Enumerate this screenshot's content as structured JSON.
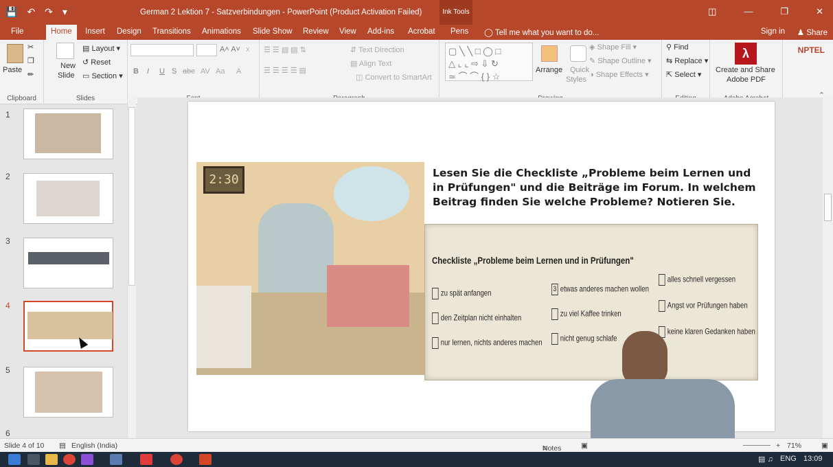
{
  "window": {
    "title": "German 2 Lektion 7 - Satzverbindungen - PowerPoint (Product Activation Failed)",
    "context_tab": "Ink Tools",
    "quick_access": [
      "save-icon",
      "undo-icon",
      "redo-icon",
      "customize-icon"
    ]
  },
  "tabs": [
    "File",
    "Home",
    "Insert",
    "Design",
    "Transitions",
    "Animations",
    "Slide Show",
    "Review",
    "View",
    "Add-ins",
    "Acrobat",
    "Pens"
  ],
  "active_tab": "Home",
  "tell_me": "Tell me what you want to do...",
  "account": {
    "signin": "Sign in",
    "share": "Share"
  },
  "ribbon": {
    "clipboard": {
      "label": "Clipboard",
      "paste": "Paste"
    },
    "slides": {
      "label": "Slides",
      "new_slide": "New",
      "new_slide2": "Slide",
      "layout": "Layout",
      "reset": "Reset",
      "section": "Section"
    },
    "font": {
      "label": "Font"
    },
    "paragraph": {
      "label": "Paragraph",
      "text_direction": "Text Direction",
      "align_text": "Align Text",
      "convert": "Convert to SmartArt"
    },
    "drawing": {
      "label": "Drawing",
      "arrange": "Arrange",
      "quick_styles": "Quick",
      "quick_styles2": "Styles",
      "shape_fill": "Shape Fill",
      "shape_outline": "Shape Outline",
      "shape_effects": "Shape Effects"
    },
    "editing": {
      "label": "Editing",
      "find": "Find",
      "replace": "Replace",
      "select": "Select"
    },
    "acrobat": {
      "label": "Adobe Acrobat",
      "create": "Create and Share",
      "create2": "Adobe PDF"
    },
    "watermark": "NPTEL"
  },
  "thumbnails": [
    {
      "num": "1"
    },
    {
      "num": "2"
    },
    {
      "num": "3"
    },
    {
      "num": "4",
      "selected": true
    },
    {
      "num": "5"
    },
    {
      "num": "6"
    }
  ],
  "slide": {
    "clock": "2:30",
    "instruction": "Lesen Sie die Checkliste „Probleme beim Lernen und in Prüfungen\" und die Beiträge im Forum. In welchem Beitrag finden Sie welche Probleme? Notieren Sie.",
    "checklist_title": "Checkliste „Probleme beim Lernen und in Prüfungen\"",
    "items": [
      {
        "text": "zu spät anfangen",
        "mark": ""
      },
      {
        "text": "etwas anderes machen wollen",
        "mark": "3"
      },
      {
        "text": "alles schnell vergessen",
        "mark": ""
      },
      {
        "text": "den Zeitplan nicht einhalten",
        "mark": ""
      },
      {
        "text": "zu viel Kaffee trinken",
        "mark": ""
      },
      {
        "text": "Angst vor Prüfungen haben",
        "mark": ""
      },
      {
        "text": "nur lernen, nichts anderes machen",
        "mark": ""
      },
      {
        "text": "nicht genug schlafe",
        "mark": ""
      },
      {
        "text": "keine klaren Gedanken haben",
        "mark": ""
      }
    ]
  },
  "status": {
    "slide_of": "Slide 4 of 10",
    "language": "English (India)",
    "notes": "Notes",
    "zoom": "71%"
  },
  "taskbar": {
    "lang": "ENG",
    "time": "13:09"
  }
}
